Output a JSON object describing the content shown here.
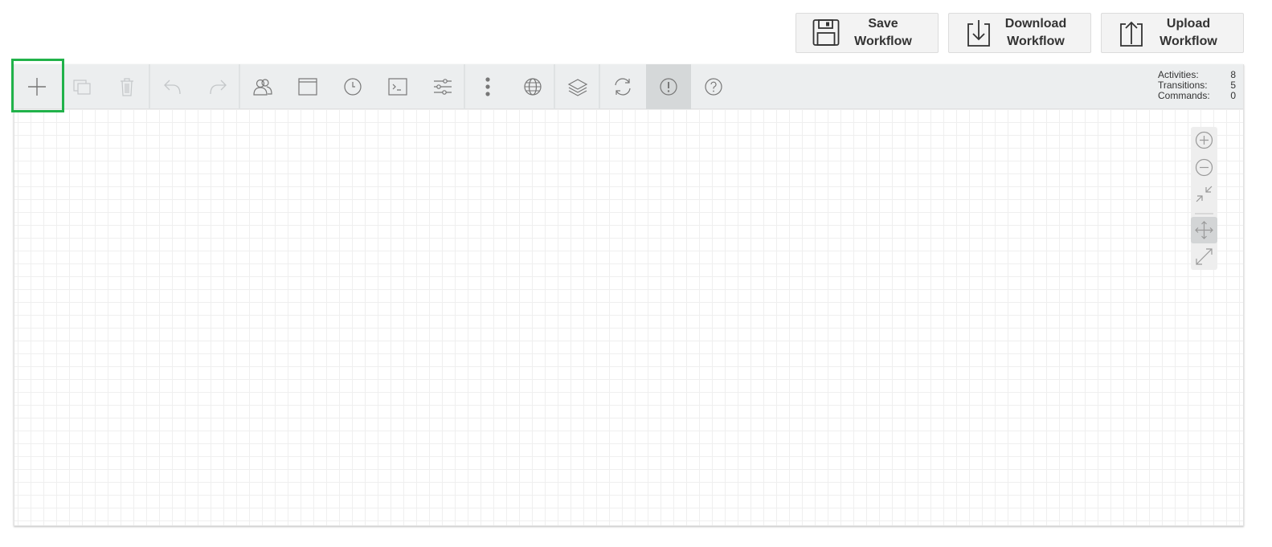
{
  "actions": {
    "save": "Save\nWorkflow",
    "download": "Download\nWorkflow",
    "upload": "Upload\nWorkflow"
  },
  "toolbar": {
    "buttons": [
      {
        "name": "create-activity",
        "icon": "plus-icon"
      },
      {
        "name": "copy",
        "icon": "copy-icon"
      },
      {
        "name": "delete",
        "icon": "trash-icon"
      },
      {
        "name": "undo",
        "icon": "undo-icon"
      },
      {
        "name": "redo",
        "icon": "redo-icon"
      },
      {
        "name": "actors",
        "icon": "users-icon"
      },
      {
        "name": "window",
        "icon": "window-icon"
      },
      {
        "name": "timers",
        "icon": "clock-icon"
      },
      {
        "name": "commands",
        "icon": "terminal-icon"
      },
      {
        "name": "parameters",
        "icon": "sliders-icon"
      },
      {
        "name": "more",
        "icon": "vertical-dots-icon"
      },
      {
        "name": "localization",
        "icon": "globe-icon"
      },
      {
        "name": "layers",
        "icon": "layers-icon"
      },
      {
        "name": "refresh",
        "icon": "refresh-icon"
      },
      {
        "name": "validate",
        "icon": "alert-icon"
      },
      {
        "name": "help",
        "icon": "help-icon"
      }
    ]
  },
  "stats": {
    "activities_label": "Activities:",
    "activities_value": "8",
    "transitions_label": "Transitions:",
    "transitions_value": "5",
    "commands_label": "Commands:",
    "commands_value": "0"
  },
  "zoom": {
    "buttons": [
      "zoom-in-icon",
      "zoom-out-icon",
      "fit-icon",
      "move-icon",
      "expand-icon"
    ]
  },
  "colors": {
    "highlight": "#21b24a",
    "toolbar_bg": "#eceeef"
  }
}
